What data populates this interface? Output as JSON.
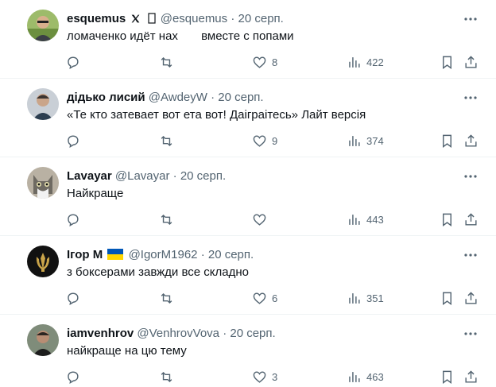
{
  "colors": {
    "text": "#0f1419",
    "muted": "#536471",
    "divider": "#eff3f4",
    "ua_blue": "#0057b7",
    "ua_yellow": "#ffd700"
  },
  "tweets": [
    {
      "name": "esquemus",
      "handle": "@esquemus",
      "date": "20 серп.",
      "text": "ломаченко идёт нах       вместе с попами",
      "likes": "8",
      "views": "422",
      "badges": [
        "x-logo-icon",
        "unknown-glyph-icon"
      ]
    },
    {
      "name": "дідько лисий",
      "handle": "@AwdeyW",
      "date": "20 серп.",
      "text": "«Те кто затевает вот ета вот! Даігpaітесь» Лайт версія",
      "likes": "9",
      "views": "374"
    },
    {
      "name": "Lavayar",
      "handle": "@Lavayar",
      "date": "20 серп.",
      "text": "Найкраще",
      "likes": "",
      "views": "443"
    },
    {
      "name": "Ігор М",
      "handle": "@IgorM1962",
      "date": "20 серп.",
      "text": "з боксерами завжди все складно",
      "likes": "6",
      "views": "351",
      "badges": [
        "ukraine-flag-icon"
      ]
    },
    {
      "name": "iamvenhrov",
      "handle": "@VenhrovVova",
      "date": "20 серп.",
      "text": "найкраще на цю тему",
      "likes": "3",
      "views": "463"
    }
  ],
  "sep": "·"
}
